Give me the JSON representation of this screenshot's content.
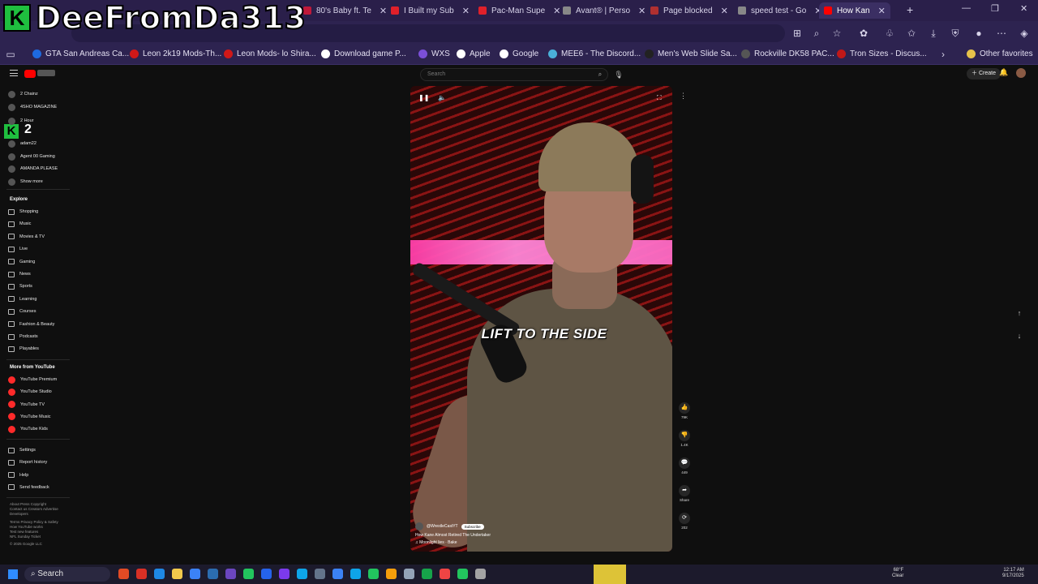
{
  "watermark": {
    "logo_letter": "K",
    "text": "DeeFromDa313"
  },
  "browser": {
    "tabs": [
      {
        "label": "80's Baby ft. Te",
        "color": "#c0193a"
      },
      {
        "label": "I Built my Sub",
        "color": "#e0202a"
      },
      {
        "label": "Pac-Man Supe",
        "color": "#e0202a"
      },
      {
        "label": "Avant® | Perso",
        "color": "#888888"
      },
      {
        "label": "Page blocked",
        "color": "#b03030"
      },
      {
        "label": "speed test - Go",
        "color": "#888888"
      },
      {
        "label": "How Kan",
        "color": "#ff0000"
      }
    ],
    "bookmarks": [
      {
        "label": "GTA San Andreas Ca...",
        "color": "#1e6adf"
      },
      {
        "label": "Leon 2k19 Mods-Th...",
        "color": "#d01818"
      },
      {
        "label": "Leon Mods- lo Shira...",
        "color": "#d01818"
      },
      {
        "label": "Download game P...",
        "color": "#ffffff"
      },
      {
        "label": "WXS",
        "color": "#7b4fd8"
      },
      {
        "label": "Apple",
        "color": "#ffffff"
      },
      {
        "label": "Google",
        "color": "#ffffff"
      },
      {
        "label": "MEE6 - The Discord...",
        "color": "#4ab0d8"
      },
      {
        "label": "Men's Web Slide Sa...",
        "color": "#222222"
      },
      {
        "label": "Rockville DK58 PAC...",
        "color": "#555555"
      },
      {
        "label": "Tron Sizes - Discus...",
        "color": "#c01818"
      },
      {
        "label": "Other favorites",
        "color": "#e6c24a"
      }
    ]
  },
  "youtube": {
    "search_placeholder": "Search",
    "create_label": "Create",
    "subscriptions": [
      {
        "label": "2 Chainz"
      },
      {
        "label": "4SHO MAGAZINE"
      },
      {
        "label": "2 Hour"
      },
      {
        "label": "adam22"
      },
      {
        "label": "Agent 00 Gaming"
      },
      {
        "label": "AMANDA PLEASE"
      },
      {
        "label": "Show more"
      }
    ],
    "k_badge": {
      "letter": "K",
      "number": "2"
    },
    "explore_header": "Explore",
    "explore": [
      "Shopping",
      "Music",
      "Movies & TV",
      "Live",
      "Gaming",
      "News",
      "Sports",
      "Learning",
      "Courses",
      "Fashion & Beauty",
      "Podcasts",
      "Playables"
    ],
    "more_header": "More from YouTube",
    "more": [
      "YouTube Premium",
      "YouTube Studio",
      "YouTube TV",
      "YouTube Music",
      "YouTube Kids"
    ],
    "settings": [
      "Settings",
      "Report history",
      "Help",
      "Send feedback"
    ],
    "footer": [
      "About  Press  Copyright",
      "Contact us  Creators  Advertise",
      "Developers",
      "Terms  Privacy  Policy & Safety",
      "How YouTube works",
      "Test new features",
      "NFL Sunday Ticket",
      "© 2025 Google LLC"
    ]
  },
  "short": {
    "caption": "LIFT TO THE SIDE",
    "channel": "@WrestleCastYT",
    "subscribe": "Subscribe",
    "title": "How Kane Almost Retired The Undertaker",
    "music": "Moonlight lies · Bake",
    "actions": [
      {
        "icon": "👍",
        "count": "79K",
        "name": "like-button"
      },
      {
        "icon": "👎",
        "count": "1.4K",
        "name": "dislike-button"
      },
      {
        "icon": "💬",
        "count": "449",
        "name": "comments-button"
      },
      {
        "icon": "➦",
        "count": "Share",
        "name": "share-button"
      },
      {
        "icon": "⟳",
        "count": "202",
        "name": "remix-button"
      }
    ]
  },
  "taskbar": {
    "search_label": "Search",
    "weather": "68°F\nClear",
    "time": "12:17 AM",
    "date": "9/17/2025"
  }
}
